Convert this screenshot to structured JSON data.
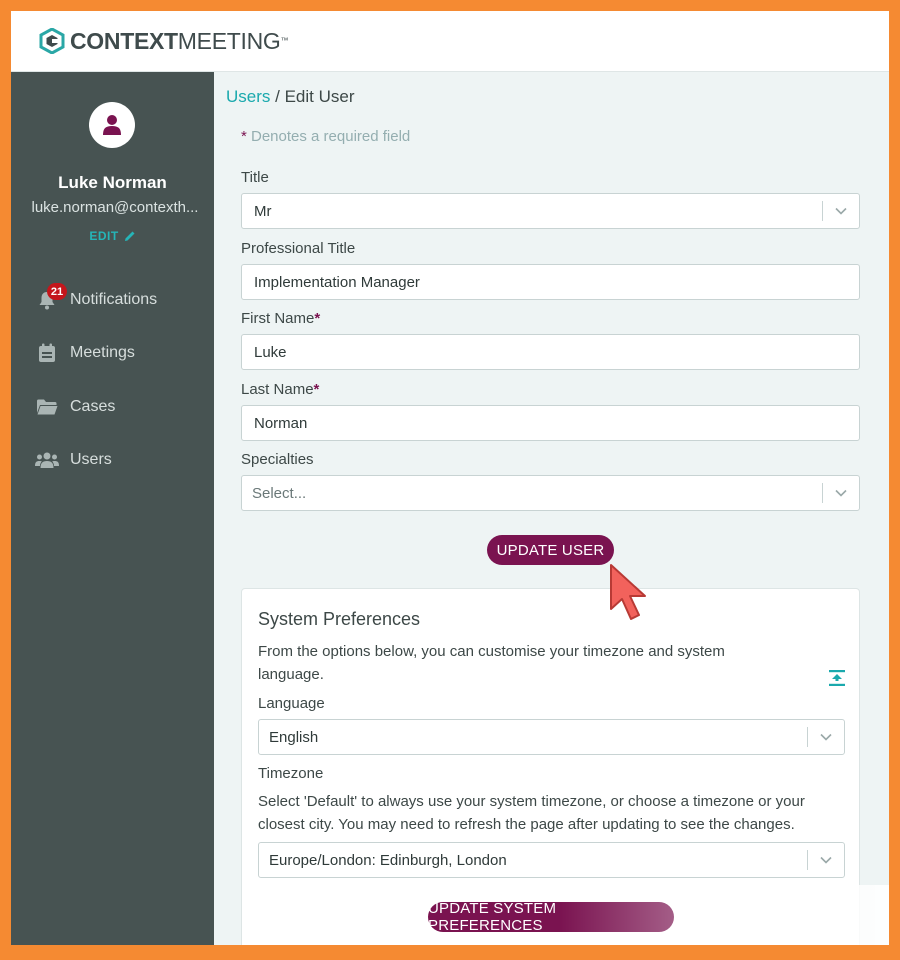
{
  "brand": {
    "bold": "CONTEXT",
    "light": "MEETING",
    "tm": "™"
  },
  "user": {
    "name": "Luke Norman",
    "email": "luke.norman@contexth...",
    "edit_label": "EDIT"
  },
  "sidebar": {
    "items": [
      {
        "label": "Notifications",
        "icon": "bell-icon",
        "badge": "21"
      },
      {
        "label": "Meetings",
        "icon": "calendar-icon"
      },
      {
        "label": "Cases",
        "icon": "folder-icon"
      },
      {
        "label": "Users",
        "icon": "users-icon"
      }
    ]
  },
  "breadcrumb": {
    "link": "Users",
    "separator": " / ",
    "current": "Edit User"
  },
  "form": {
    "required_star": "*",
    "required_note": " Denotes a required field",
    "title": {
      "label": "Title",
      "value": "Mr"
    },
    "professional_title": {
      "label": "Professional Title",
      "value": "Implementation Manager"
    },
    "first_name": {
      "label": "First Name",
      "required": "*",
      "value": "Luke"
    },
    "last_name": {
      "label": "Last Name",
      "required": "*",
      "value": "Norman"
    },
    "specialties": {
      "label": "Specialties",
      "placeholder": "Select..."
    },
    "submit_label": "UPDATE USER"
  },
  "preferences": {
    "title": "System Preferences",
    "description": "From the options below, you can customise your timezone and system language.",
    "language": {
      "label": "Language",
      "value": "English"
    },
    "timezone": {
      "label": "Timezone",
      "help": "Select 'Default' to always use your system timezone, or choose a timezone or your closest city. You may need to refresh the page after updating to see the changes.",
      "value": "Europe/London: Edinburgh, London"
    },
    "submit_label": "UPDATE SYSTEM PREFERENCES"
  },
  "colors": {
    "frame": "#f58a32",
    "sidebar": "#475352",
    "accent": "#1aa9ad",
    "primary_button": "#7a1350",
    "badge": "#c4161c"
  }
}
